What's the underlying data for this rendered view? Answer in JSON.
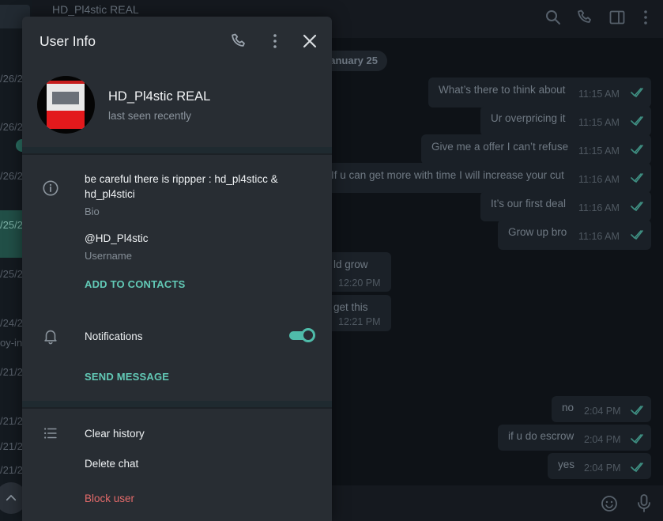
{
  "chat_header": {
    "title": "HD_Pl4stic REAL"
  },
  "chat_list": {
    "dates": [
      "/26/2",
      "/26/2",
      "/26/2",
      "/25/2",
      "/25/2",
      "/24/2",
      "/21/2",
      "/21/2",
      "/21/2",
      "/21/2"
    ],
    "snippet": "oy-in"
  },
  "chat": {
    "date_label": "January 25",
    "messages": [
      {
        "text": "What’s there to think about",
        "time": "11:15 AM"
      },
      {
        "text": "Ur overpricing it",
        "time": "11:15 AM"
      },
      {
        "text": "Give me a offer I can’t refuse",
        "time": "11:15 AM"
      },
      {
        "text": "If u can get more with time I will increase your cut",
        "time": "11:16 AM"
      },
      {
        "text": "It’s our first deal",
        "time": "11:16 AM"
      },
      {
        "text": "Grow up bro",
        "time": "11:16 AM"
      },
      {
        "text": "ld grow",
        "time": "12:20 PM"
      },
      {
        "text": "get this",
        "time": "12:21 PM"
      },
      {
        "text": "no",
        "time": "2:04 PM"
      },
      {
        "text": "if u do escrow",
        "time": "2:04 PM"
      },
      {
        "text": "yes",
        "time": "2:04 PM"
      }
    ]
  },
  "user_info": {
    "title": "User Info",
    "name": "HD_Pl4stic REAL",
    "status": "last seen recently",
    "bio": "be careful there is rippper : hd_pl4sticc & hd_pl4stici",
    "bio_label": "Bio",
    "username": "@HD_Pl4stic",
    "username_label": "Username",
    "add_contact": "ADD TO CONTACTS",
    "notifications_label": "Notifications",
    "notifications_on": true,
    "send_message": "SEND MESSAGE",
    "clear_history": "Clear history",
    "delete_chat": "Delete chat",
    "block_user": "Block user"
  },
  "colors": {
    "accent": "#62c9b6",
    "danger": "#e36a6a",
    "panel_bg": "#282d33",
    "read_ticks": "#3f8f82"
  }
}
